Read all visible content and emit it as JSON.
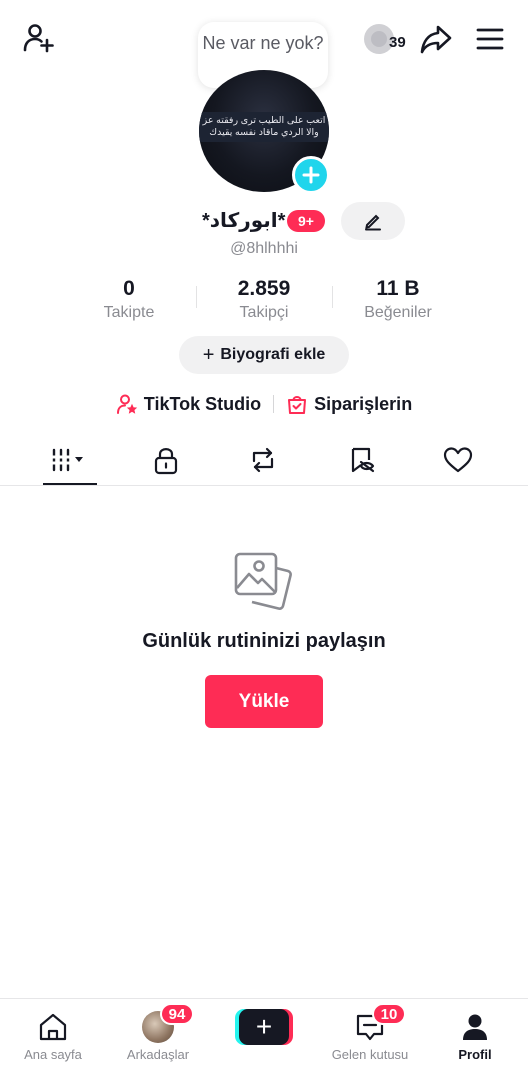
{
  "header": {
    "coins": "39",
    "note_bubble": "Ne var ne yok?"
  },
  "profile": {
    "avatar_text_line1": "اتعب على الطيب ترى رفقته عز",
    "avatar_text_line2": "والا الردي ماقاد نفسه يقيدك",
    "display_name": "*ابوركاد*",
    "name_badge": "9+",
    "handle": "@8hlhhhi"
  },
  "stats": [
    {
      "value": "0",
      "label": "Takipte"
    },
    {
      "value": "2.859",
      "label": "Takipçi"
    },
    {
      "value": "11 B",
      "label": "Beğeniler"
    }
  ],
  "bio_button": {
    "plus": "+",
    "label": "Biyografi ekle"
  },
  "links": {
    "studio": "TikTok Studio",
    "orders": "Siparişlerin"
  },
  "tabs": [
    "videos-grid",
    "private",
    "reposts",
    "favorites",
    "liked"
  ],
  "empty_state": {
    "title": "Günlük rutininizi paylaşın",
    "button": "Yükle"
  },
  "bottom_nav": {
    "home": "Ana sayfa",
    "friends": "Arkadaşlar",
    "friends_badge": "94",
    "create": "+",
    "inbox": "Gelen kutusu",
    "inbox_badge": "10",
    "profile": "Profil"
  },
  "colors": {
    "accent": "#fe2c55",
    "cyan": "#20d5ec",
    "text": "#161823",
    "muted": "#8a8b91"
  }
}
